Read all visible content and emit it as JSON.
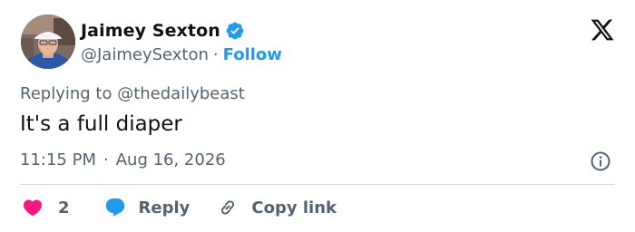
{
  "author": {
    "name": "Jaimey Sexton",
    "handle": "@JaimeySexton",
    "separator": "·",
    "follow_label": "Follow",
    "verified": true
  },
  "tweet": {
    "replying_to": "Replying to @thedailybeast",
    "text": "It's a full diaper",
    "time": "11:15 PM",
    "time_separator": "·",
    "date": "Aug 16, 2026"
  },
  "actions": {
    "like_count": "2",
    "reply_label": "Reply",
    "copy_label": "Copy link"
  },
  "icons": {
    "logo": "x-logo-icon",
    "verified": "verified-badge-icon",
    "info": "info-icon",
    "like": "heart-icon",
    "reply": "speech-bubble-icon",
    "copy": "link-icon"
  },
  "colors": {
    "accent": "#1d9bf0",
    "like": "#f91880",
    "secondary_text": "#536471",
    "primary_text": "#0f1419",
    "divider": "#cfd9de"
  }
}
